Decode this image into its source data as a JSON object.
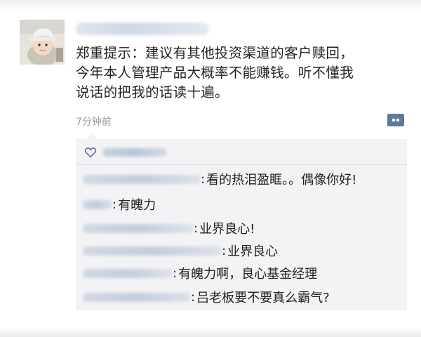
{
  "post": {
    "lines": [
      "郑重提示：建议有其他投资渠道的客户赎回，",
      "今年本人管理产品大概率不能赚钱。听不懂我",
      "说话的把我的话读十遍。"
    ],
    "timestamp": "7分钟前"
  },
  "icons": {
    "like": "heart-outline-icon",
    "comment": "comment-dots-icon",
    "avatar": "child-photo-avatar"
  },
  "colors": {
    "text": "#222222",
    "timestamp": "#9a9a9a",
    "comment_area_bg": "#f3f3f5",
    "comment_button": "#5f7a96",
    "link_blue": "#576b95"
  },
  "comments": [
    {
      "separator": ":",
      "text": "看的热泪盈眶。。偶像你好!"
    },
    {
      "separator": ":",
      "text": "有魄力"
    },
    {
      "separator": ":",
      "text": "业界良心!"
    },
    {
      "separator": ":",
      "text": "业界良心"
    },
    {
      "separator": ":",
      "text": "有魄力啊，良心基金经理"
    },
    {
      "separator": ":",
      "text": "吕老板要不要真么霸气?"
    }
  ]
}
